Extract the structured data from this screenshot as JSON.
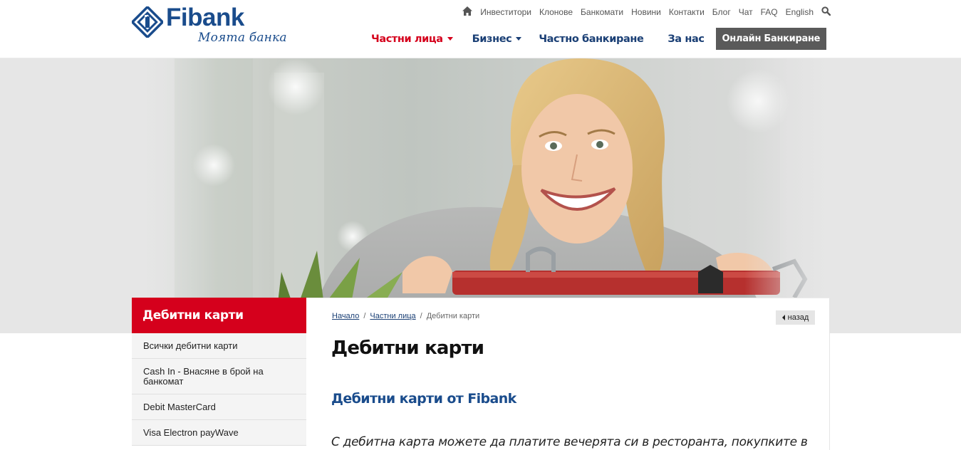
{
  "brand": {
    "name": "Fibank",
    "tagline": "Моята банка",
    "colors": {
      "primary_blue": "#1a4c8c",
      "accent_red": "#d5001c",
      "online_button": "#5a5a5a"
    }
  },
  "utility_nav": {
    "home_icon": "home-icon",
    "items": [
      "Инвеститори",
      "Клонове",
      "Банкомати",
      "Новини",
      "Контакти",
      "Блог",
      "Чат",
      "FAQ",
      "English"
    ],
    "search_icon": "search-icon"
  },
  "main_nav": {
    "items": [
      {
        "label": "Частни лица",
        "active": true,
        "dropdown": true
      },
      {
        "label": "Бизнес",
        "active": false,
        "dropdown": true
      },
      {
        "label": "Частно банкиране",
        "active": false,
        "dropdown": false
      },
      {
        "label": "За нас",
        "active": false,
        "dropdown": false
      }
    ],
    "online_banking": "Онлайн Банкиране"
  },
  "sidebar": {
    "title": "Дебитни карти",
    "items": [
      {
        "label": "Всички дебитни карти"
      },
      {
        "label": "Cash In - Внасяне в брой на банкомат"
      },
      {
        "label": "Debit MasterCard"
      },
      {
        "label": "Visa Electron payWave"
      }
    ]
  },
  "content": {
    "breadcrumb": {
      "home": "Начало",
      "section": "Частни лица",
      "current": "Дебитни карти",
      "separator": "/"
    },
    "back_label": "назад",
    "title": "Дебитни карти",
    "subtitle": "Дебитни карти от Fibank",
    "body": "С дебитна карта можете да платите вечерята си в ресторанта, покупките в"
  }
}
